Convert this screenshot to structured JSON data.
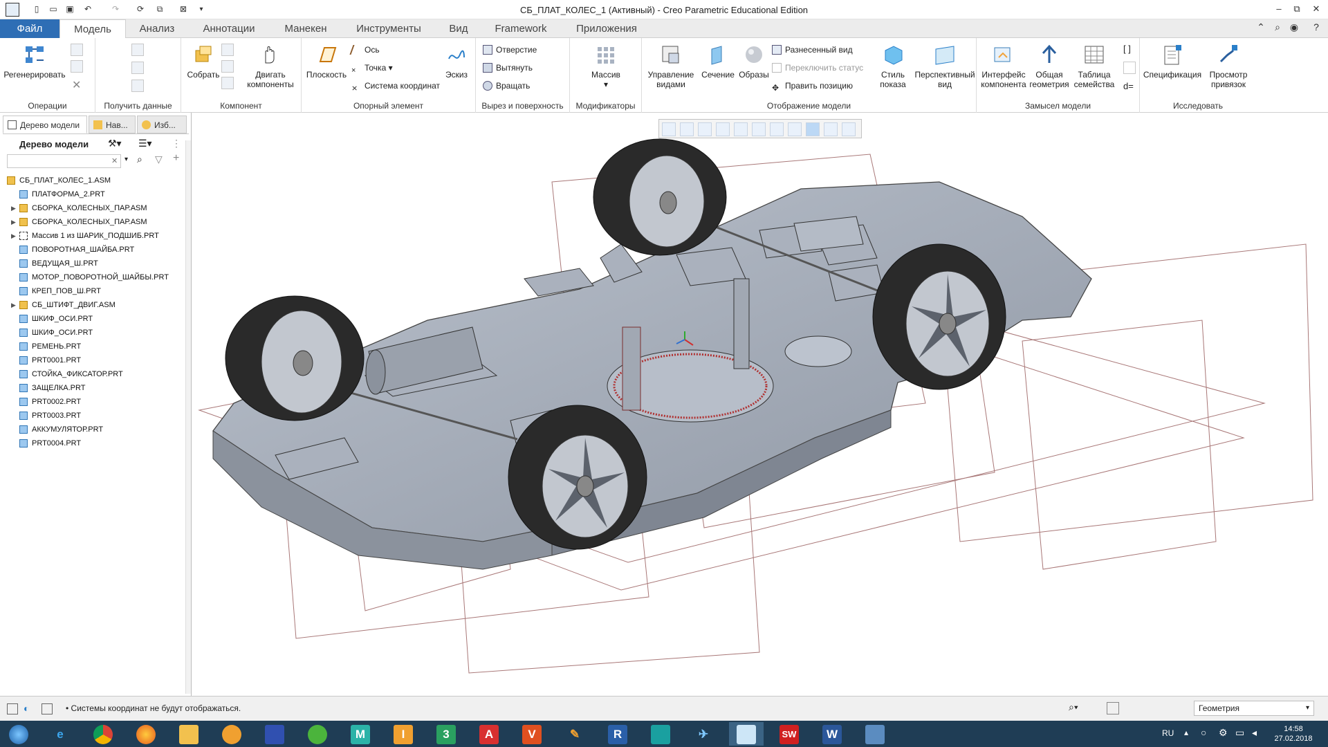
{
  "window": {
    "title": "СБ_ПЛАТ_КОЛЕС_1 (Активный) - Creo Parametric Educational Edition",
    "controls": {
      "minimize": "–",
      "maximize": "⧉",
      "close": "✕"
    }
  },
  "quick_access": {
    "icons": [
      "new-icon",
      "open-icon",
      "save-icon",
      "undo-icon",
      "redo-icon",
      "regenerate-icon",
      "windows-icon",
      "close-window-icon",
      "customize-icon"
    ]
  },
  "ribbon_tabs": [
    {
      "label": "Файл"
    },
    {
      "label": "Модель"
    },
    {
      "label": "Анализ"
    },
    {
      "label": "Аннотации"
    },
    {
      "label": "Манекен"
    },
    {
      "label": "Инструменты"
    },
    {
      "label": "Вид"
    },
    {
      "label": "Framework"
    },
    {
      "label": "Приложения"
    }
  ],
  "ribbon": {
    "groups": {
      "operations": "Операции",
      "get_data": "Получить данные",
      "component": "Компонент",
      "datum": "Опорный элемент",
      "cut_surface": "Вырез и поверхность",
      "modifiers": "Модификаторы",
      "model_display": "Отображение модели",
      "design_intent": "Замысел модели",
      "investigate": "Исследовать"
    },
    "buttons": {
      "regenerate": "Регенерировать",
      "assemble": "Собрать",
      "drag_components": "Двигать компоненты",
      "plane": "Плоскость",
      "axis": "Ось",
      "point": "Точка",
      "coordinate_system": "Система координат",
      "sketch": "Эскиз",
      "hole": "Отверстие",
      "extrude": "Вытянуть",
      "revolve": "Вращать",
      "pattern": "Массив",
      "manage_views": "Управление видами",
      "section": "Сечение",
      "appearances": "Образы",
      "exploded_view": "Разнесенный вид",
      "toggle_status": "Переключить статус",
      "edit_position": "Править позицию",
      "display_style": "Стиль показа",
      "perspective_view": "Перспективный вид",
      "component_interface": "Интерфейс компонента",
      "shared_geometry": "Общая геометрия",
      "family_table": "Таблица семейства",
      "bill_of_materials": "Спецификация",
      "reference_viewer": "Просмотр привязок"
    }
  },
  "left_panel": {
    "tabs": [
      {
        "label": "Дерево модели"
      },
      {
        "label": "Нав..."
      },
      {
        "label": "Изб..."
      }
    ],
    "header": "Дерево модели",
    "search_placeholder": "",
    "tree": [
      {
        "label": "СБ_ПЛАТ_КОЛЕС_1.ASM",
        "type": "asm",
        "level": 0,
        "expandable": false
      },
      {
        "label": "ПЛАТФОРМА_2.PRT",
        "type": "prt",
        "level": 1,
        "expandable": false
      },
      {
        "label": "СБОРКА_КОЛЕСНЫХ_ПАР.ASM",
        "type": "asm",
        "level": 1,
        "expandable": true
      },
      {
        "label": "СБОРКА_КОЛЕСНЫХ_ПАР.ASM",
        "type": "asm",
        "level": 1,
        "expandable": true
      },
      {
        "label": "Массив 1 из ШАРИК_ПОДШИБ.PRT",
        "type": "pattern",
        "level": 1,
        "expandable": true
      },
      {
        "label": "ПОВОРОТНАЯ_ШАЙБА.PRT",
        "type": "prt",
        "level": 1,
        "expandable": false
      },
      {
        "label": "ВЕДУЩАЯ_Ш.PRT",
        "type": "prt",
        "level": 1,
        "expandable": false
      },
      {
        "label": "МОТОР_ПОВОРОТНОЙ_ШАЙБЫ.PRT",
        "type": "prt",
        "level": 1,
        "expandable": false
      },
      {
        "label": "КРЕП_ПОВ_Ш.PRT",
        "type": "prt",
        "level": 1,
        "expandable": false
      },
      {
        "label": "СБ_ШТИФТ_ДВИГ.ASM",
        "type": "asm",
        "level": 1,
        "expandable": true
      },
      {
        "label": "ШКИФ_ОСИ.PRT",
        "type": "prt",
        "level": 1,
        "expandable": false
      },
      {
        "label": "ШКИФ_ОСИ.PRT",
        "type": "prt",
        "level": 1,
        "expandable": false
      },
      {
        "label": "РЕМЕНЬ.PRT",
        "type": "prt",
        "level": 1,
        "expandable": false
      },
      {
        "label": "PRT0001.PRT",
        "type": "prt",
        "level": 1,
        "expandable": false
      },
      {
        "label": "СТОЙКА_ФИКСАТОР.PRT",
        "type": "prt",
        "level": 1,
        "expandable": false
      },
      {
        "label": "ЗАЩЕЛКА.PRT",
        "type": "prt",
        "level": 1,
        "expandable": false
      },
      {
        "label": "PRT0002.PRT",
        "type": "prt",
        "level": 1,
        "expandable": false
      },
      {
        "label": "PRT0003.PRT",
        "type": "prt",
        "level": 1,
        "expandable": false
      },
      {
        "label": "АККУМУЛЯТОР.PRT",
        "type": "prt",
        "level": 1,
        "expandable": false
      },
      {
        "label": "PRT0004.PRT",
        "type": "prt",
        "level": 1,
        "expandable": false
      }
    ]
  },
  "status": {
    "message": "• Системы координат не будут отображаться.",
    "filter_value": "Геометрия"
  },
  "taskbar": {
    "apps": [
      "start",
      "internet-explorer",
      "chrome",
      "firefox",
      "explorer",
      "media-player",
      "floppy",
      "utorrent",
      "mathcad",
      "inventor",
      "kompas",
      "autocad",
      "vector-app",
      "pencil-app",
      "revit",
      "3ds-max",
      "creo-app",
      "creo-window",
      "solidworks",
      "word",
      "window-app"
    ],
    "app_texts": {
      "mathcad": "M",
      "inventor": "I",
      "kompas": "3",
      "autocad": "A",
      "vector-app": "V",
      "revit": "R",
      "solidworks": "SW",
      "word": "W"
    },
    "lang": "RU",
    "time": "14:58",
    "date": "27.02.2018"
  },
  "colors": {
    "accent": "#2e6eb5",
    "body_fill": "#a8afba",
    "tire": "#2a2a2a",
    "wireframe": "#7a2e2e"
  }
}
